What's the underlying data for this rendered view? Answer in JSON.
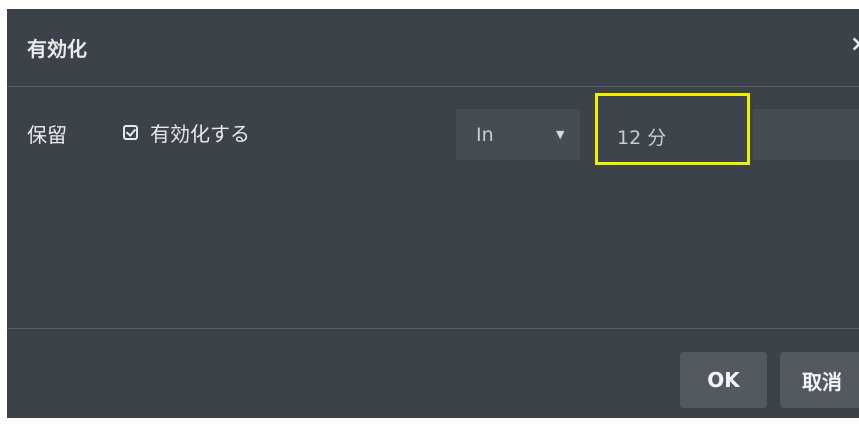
{
  "dialog": {
    "title": "有効化",
    "close_icon": "×"
  },
  "row": {
    "label": "保留",
    "checkbox": {
      "checked": true,
      "icon": "checkbox-checked-icon",
      "label": "有効化する"
    },
    "unit_select": {
      "value": "In",
      "caret": "▼"
    },
    "duration": {
      "value": "12 分"
    }
  },
  "footer": {
    "ok_label": "OK",
    "cancel_label": "取消"
  },
  "colors": {
    "dialog_bg": "#3c424a",
    "highlight": "#f0f000",
    "button_bg": "#535960",
    "text": "#e8e9eb"
  }
}
